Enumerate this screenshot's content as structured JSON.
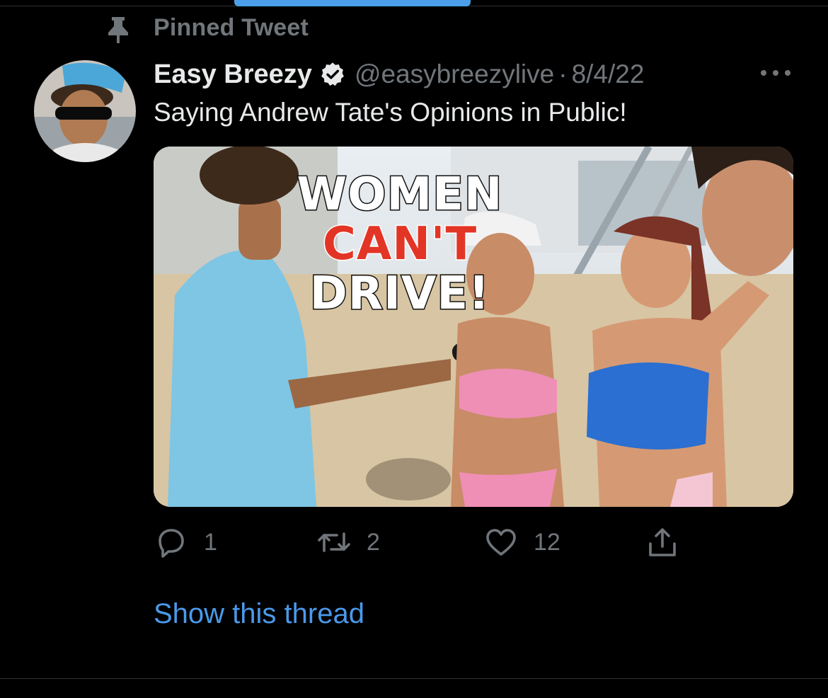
{
  "pinned": {
    "label": "Pinned Tweet",
    "icon": "pin-icon"
  },
  "tweet": {
    "author": {
      "display_name": "Easy Breezy",
      "handle": "@easybreezylive",
      "verified": true,
      "verified_icon": "verified-badge-icon"
    },
    "separator": "·",
    "date": "8/4/22",
    "text": "Saying Andrew Tate's Opinions in Public!",
    "media": {
      "thumbnail_text": [
        "WOMEN",
        "CAN'T",
        "DRIVE!"
      ]
    },
    "actions": {
      "replies": "1",
      "retweets": "2",
      "likes": "12"
    },
    "show_thread": "Show this thread"
  },
  "colors": {
    "background": "#000000",
    "primary_text": "#e7e9ea",
    "secondary_text": "#71767b",
    "link": "#4a99e9",
    "accent_red": "#e33525"
  }
}
